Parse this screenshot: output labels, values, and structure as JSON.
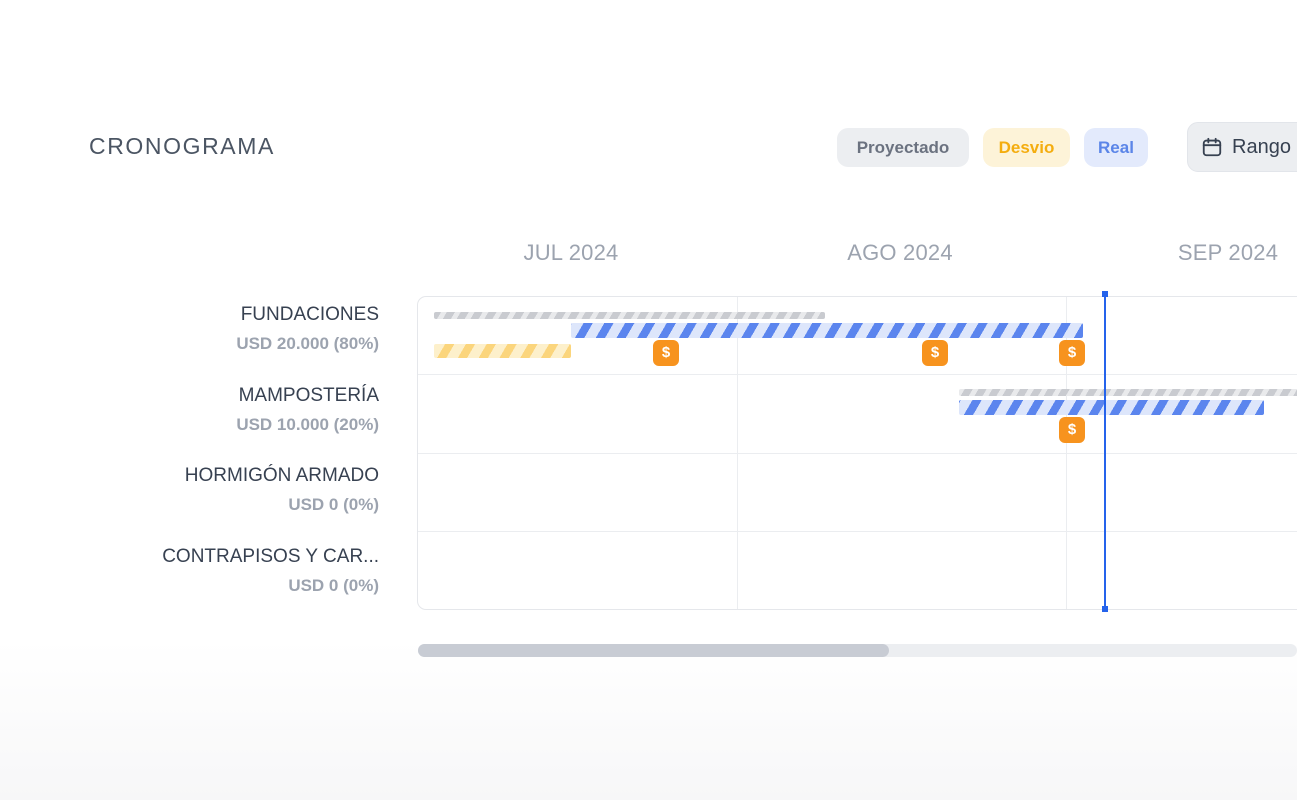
{
  "header": {
    "title": "CRONOGRAMA",
    "legend": {
      "projected": "Proyectado",
      "deviation": "Desvio",
      "real": "Real"
    },
    "range_button": {
      "label": "Rango",
      "icon": "calendar-icon"
    }
  },
  "timeline": {
    "months": [
      "JUL 2024",
      "AGO 2024",
      "SEP 2024"
    ]
  },
  "tasks": [
    {
      "name": "FUNDACIONES",
      "amount": "USD 20.000 (80%)"
    },
    {
      "name": "MAMPOSTERÍA",
      "amount": "USD 10.000 (20%)"
    },
    {
      "name": "HORMIGÓN ARMADO",
      "amount": "USD 0 (0%)"
    },
    {
      "name": "CONTRAPISOS Y CAR...",
      "amount": "USD 0 (0%)"
    }
  ],
  "payment_marker": {
    "symbol": "$",
    "icon": "dollar-icon"
  },
  "colors": {
    "today_line": "#2563eb",
    "real": "#5b85ee",
    "deviation": "#f4ad0f",
    "projected": "#c9cbd0",
    "payment": "#f7931e"
  }
}
